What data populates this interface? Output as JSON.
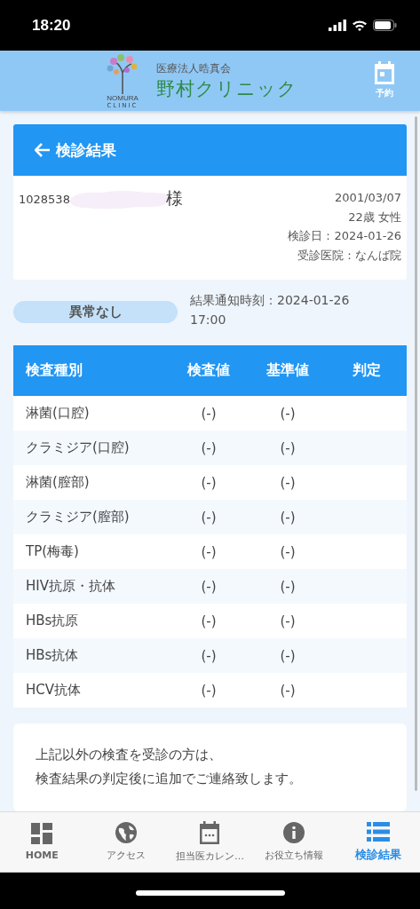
{
  "status_bar": {
    "time": "18:20"
  },
  "header": {
    "org": "医療法人晧真会",
    "name": "野村クリニック",
    "logo_text": "NOMURA",
    "logo_sub": "CLINIC",
    "action": "予約"
  },
  "page_title": "検診結果",
  "patient": {
    "id": "1028538",
    "honorific": "様",
    "birth": "2001/03/07",
    "age_sex": "22歳 女性",
    "exam_date": "検診日：2024-01-26",
    "clinic": "受診医院：なんば院"
  },
  "result_badge": "異常なし",
  "notified": "結果通知時刻：2024-01-26 17:00",
  "table": {
    "columns": [
      "検査種別",
      "検査値",
      "基準値",
      "判定"
    ],
    "rows": [
      {
        "name": "淋菌(口腔)",
        "value": "(-)",
        "reference": "(-)"
      },
      {
        "name": "クラミジア(口腔)",
        "value": "(-)",
        "reference": "(-)"
      },
      {
        "name": "淋菌(膣部)",
        "value": "(-)",
        "reference": "(-)"
      },
      {
        "name": "クラミジア(膣部)",
        "value": "(-)",
        "reference": "(-)"
      },
      {
        "name": "TP(梅毒)",
        "value": "(-)",
        "reference": "(-)"
      },
      {
        "name": "HIV抗原・抗体",
        "value": "(-)",
        "reference": "(-)"
      },
      {
        "name": "HBs抗原",
        "value": "(-)",
        "reference": "(-)"
      },
      {
        "name": "HBs抗体",
        "value": "(-)",
        "reference": "(-)"
      },
      {
        "name": "HCV抗体",
        "value": "(-)",
        "reference": "(-)"
      }
    ]
  },
  "note": [
    "上記以外の検査を受診の方は、",
    "検査結果の判定後に追加でご連絡致します。"
  ],
  "tabs": [
    {
      "label": "HOME",
      "kind": "grid",
      "selected": false
    },
    {
      "label": "アクセス",
      "kind": "globe",
      "selected": false
    },
    {
      "label": "担当医カレン…",
      "kind": "calendar",
      "selected": false
    },
    {
      "label": "お役立ち情報",
      "kind": "info",
      "selected": false
    },
    {
      "label": "検診結果",
      "kind": "list",
      "selected": true
    }
  ]
}
